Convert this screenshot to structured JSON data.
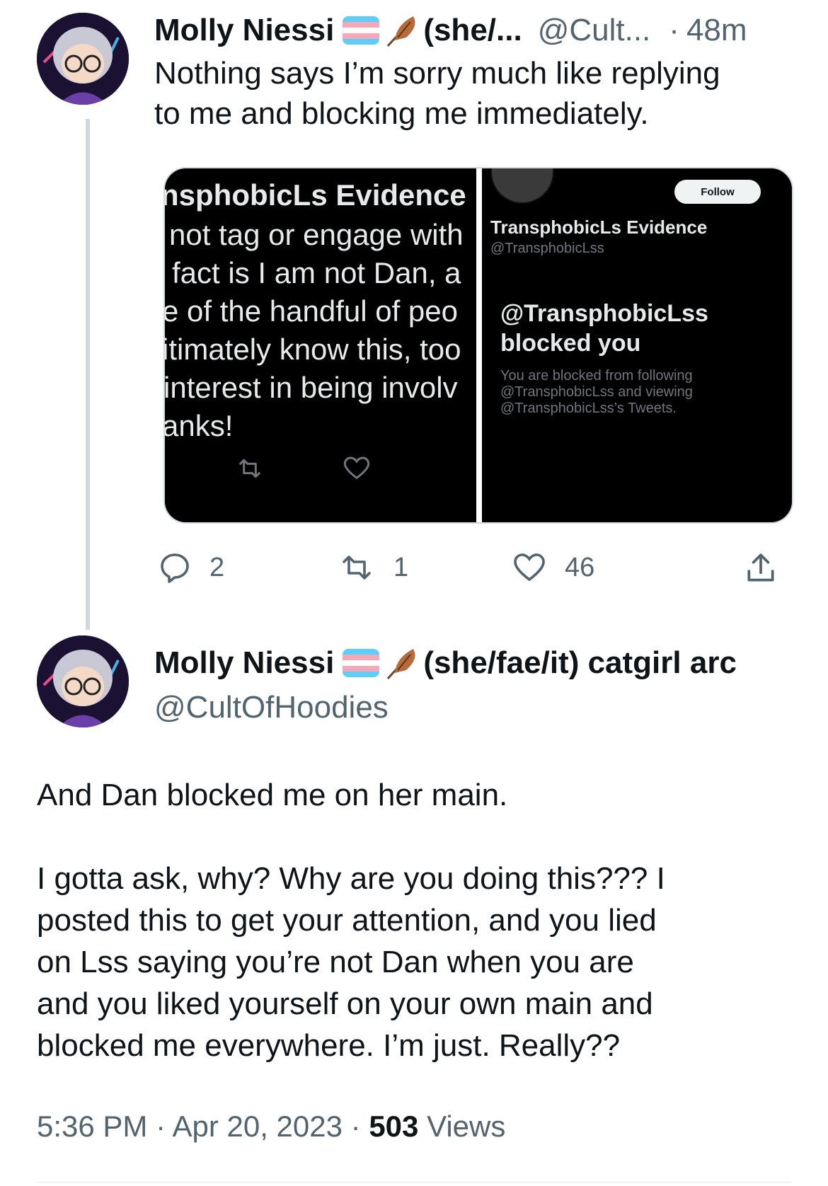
{
  "reply_tweet": {
    "author_name": "Molly Niessi",
    "pronouns_truncated": "(she/...",
    "handle_truncated": "@Cult...",
    "time_separator": "·",
    "time_ago": "48m",
    "text": "Nothing says I’m sorry much like replying\nto me and blocking me immediately.",
    "media": {
      "left": {
        "lines": [
          "nsphobicLs Evidence",
          "not tag or engage with",
          "fact is I am not Dan, a",
          "e of the handful of peo",
          "itimately know this, too",
          "interest in being involv",
          "anks!"
        ]
      },
      "right": {
        "follow_label": "Follow",
        "profile_name": "TransphobicLs Evidence",
        "profile_handle": "@TransphobicLss",
        "blocked_title_line1": "@TransphobicLss",
        "blocked_title_line2": "blocked you",
        "blocked_desc": "You are blocked from following\n@TransphobicLss and viewing\n@TransphobicLss’s Tweets."
      }
    },
    "actions": {
      "replies": "2",
      "retweets": "1",
      "likes": "46"
    }
  },
  "main_tweet": {
    "author_name": "Molly Niessi",
    "pronouns": "(she/fae/it) catgirl arc",
    "handle": "@CultOfHoodies",
    "text": "And Dan blocked me on her main.\n\nI gotta ask, why? Why are you doing this??? I\nposted this to get your attention, and you lied\non Lss saying you’re not Dan when you are\nand you liked yourself on your own main and\nblocked me everywhere. I’m just. Really??",
    "time": "5:36 PM",
    "separator": "·",
    "date": "Apr 20, 2023",
    "views_count": "503",
    "views_label": "Views"
  },
  "colors": {
    "trans_flag": [
      "#5bcefa",
      "#f5a9b8",
      "#ffffff",
      "#f5a9b8",
      "#5bcefa"
    ],
    "muted": "#536471",
    "thread_line": "#cfd9de"
  },
  "icons": [
    "trans-flag-icon",
    "feather-icon",
    "reply-icon",
    "retweet-icon",
    "like-icon",
    "share-icon"
  ]
}
